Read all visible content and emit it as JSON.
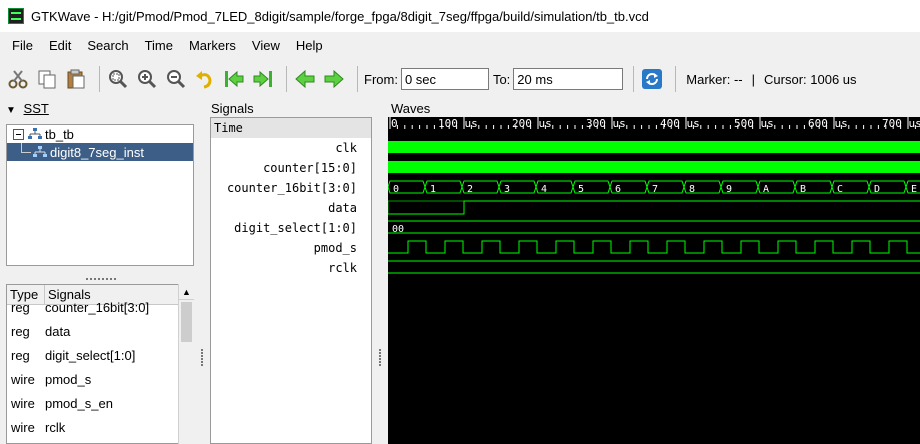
{
  "window": {
    "title": "GTKWave - H:/git/Pmod/Pmod_7LED_8digit/sample/forge_fpga/8digit_7seg/ffpga/build/simulation/tb_tb.vcd"
  },
  "menu": [
    "File",
    "Edit",
    "Search",
    "Time",
    "Markers",
    "View",
    "Help"
  ],
  "toolbar": {
    "from_label": "From:",
    "from_value": "0 sec",
    "to_label": "To:",
    "to_value": "20 ms",
    "marker_text": "Marker: --",
    "separator_text": "|",
    "cursor_text": "Cursor: 1006 us",
    "icons": [
      "cut-icon",
      "copy-icon",
      "paste-icon",
      "zoom-fit-icon",
      "zoom-in-icon",
      "zoom-out-icon",
      "undo-zoom-icon",
      "zoom-start-icon",
      "zoom-end-icon",
      "prev-edge-icon",
      "next-edge-icon",
      "reload-icon"
    ]
  },
  "sst": {
    "title": "SST",
    "tree": [
      {
        "label": "tb_tb"
      },
      {
        "label": "digit8_7seg_inst"
      }
    ],
    "table": {
      "headers": [
        "Type",
        "Signals"
      ],
      "rows": [
        {
          "type": "reg",
          "name": "counter_16bit[3:0]"
        },
        {
          "type": "reg",
          "name": "data"
        },
        {
          "type": "reg",
          "name": "digit_select[1:0]"
        },
        {
          "type": "wire",
          "name": "pmod_s"
        },
        {
          "type": "wire",
          "name": "pmod_s_en"
        },
        {
          "type": "wire",
          "name": "rclk"
        }
      ]
    }
  },
  "signals": {
    "title": "Signals",
    "time_label": "Time",
    "names": [
      "clk",
      "counter[15:0]",
      "counter_16bit[3:0]",
      "data",
      "digit_select[1:0]",
      "pmod_s",
      "rclk"
    ]
  },
  "waves": {
    "title": "Waves",
    "ticks": [
      "0",
      "100 us",
      "200 us",
      "300 us",
      "400 us",
      "500 us",
      "600 us",
      "700 us"
    ],
    "counter_16bit_values": [
      "0",
      "1",
      "2",
      "3",
      "4",
      "5",
      "6",
      "7",
      "8",
      "9",
      "A",
      "B",
      "C",
      "D",
      "E"
    ],
    "digit_select_value": "00",
    "wave_color": "#00ff00"
  }
}
